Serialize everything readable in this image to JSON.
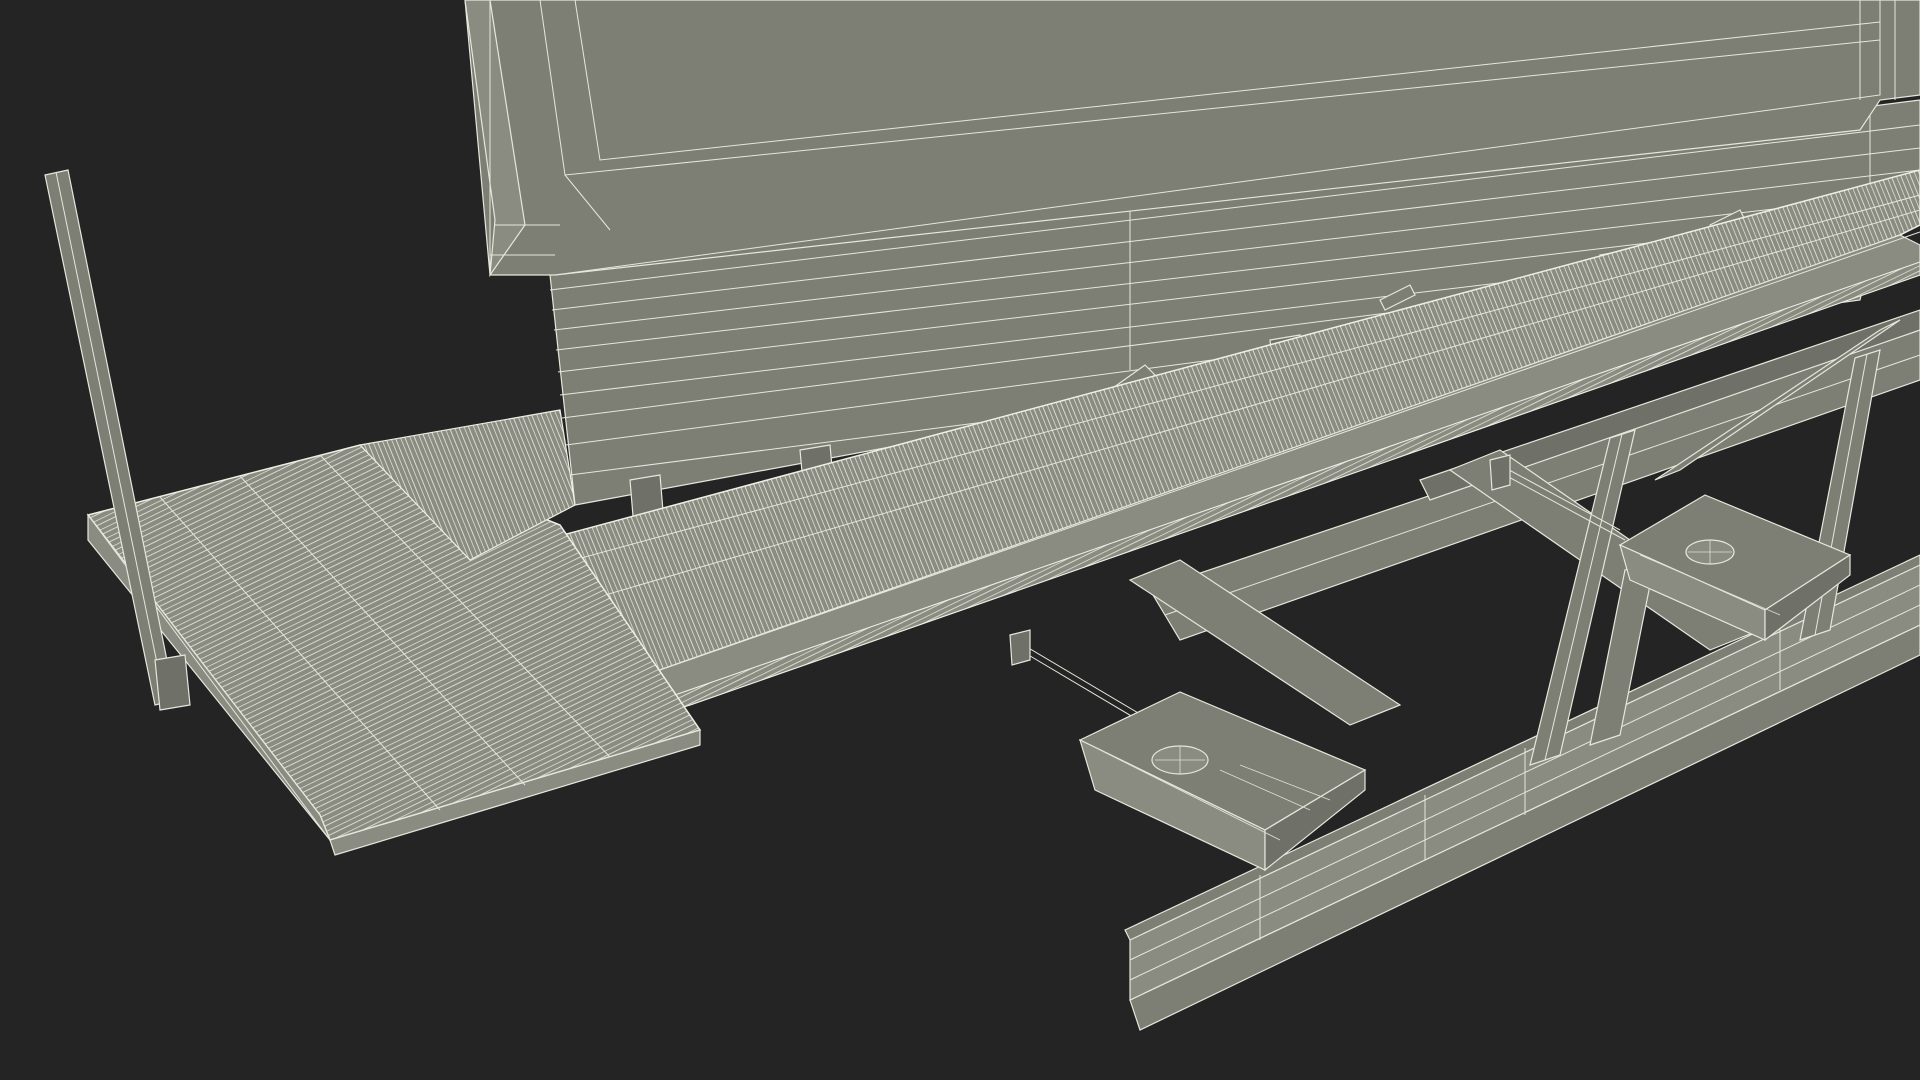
{
  "scene": {
    "subject": "billboard-walkway-wireframe",
    "render_mode": "wireframe-on-shaded",
    "colors": {
      "background": "#242424",
      "surface": "#7d7e74",
      "surface_dark": "#6f7067",
      "surface_light": "#8a8b81",
      "wire": "#e6e7dc"
    }
  }
}
